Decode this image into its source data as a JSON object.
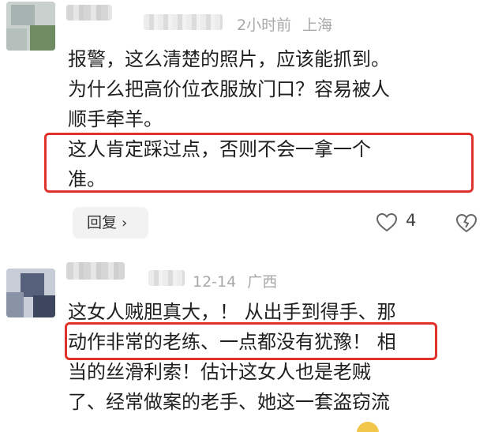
{
  "comments": [
    {
      "time": "2小时前",
      "location": "上海",
      "lines": [
        "报警，这么清楚的照片，应该能抓到。",
        "为什么把高价位衣服放门口？容易被人",
        "顺手牵羊。",
        "这人肯定踩过点，否则不会一拿一个",
        "准。"
      ],
      "reply_label": "回复",
      "like_count": "4"
    },
    {
      "time": "12-14",
      "location": "广西",
      "lines": [
        "这女人贼胆真大，！ 从出手到得手、那",
        "动作非常的老练、一点都没有犹豫！ 相",
        "当的丝滑利索！估计这女人也是老贼",
        "了、经常做案的老手、她这一套盗窃流"
      ]
    }
  ],
  "colors": {
    "highlight": "#e0322a",
    "meta": "#a8a8a8",
    "text": "#1f1f1f"
  }
}
